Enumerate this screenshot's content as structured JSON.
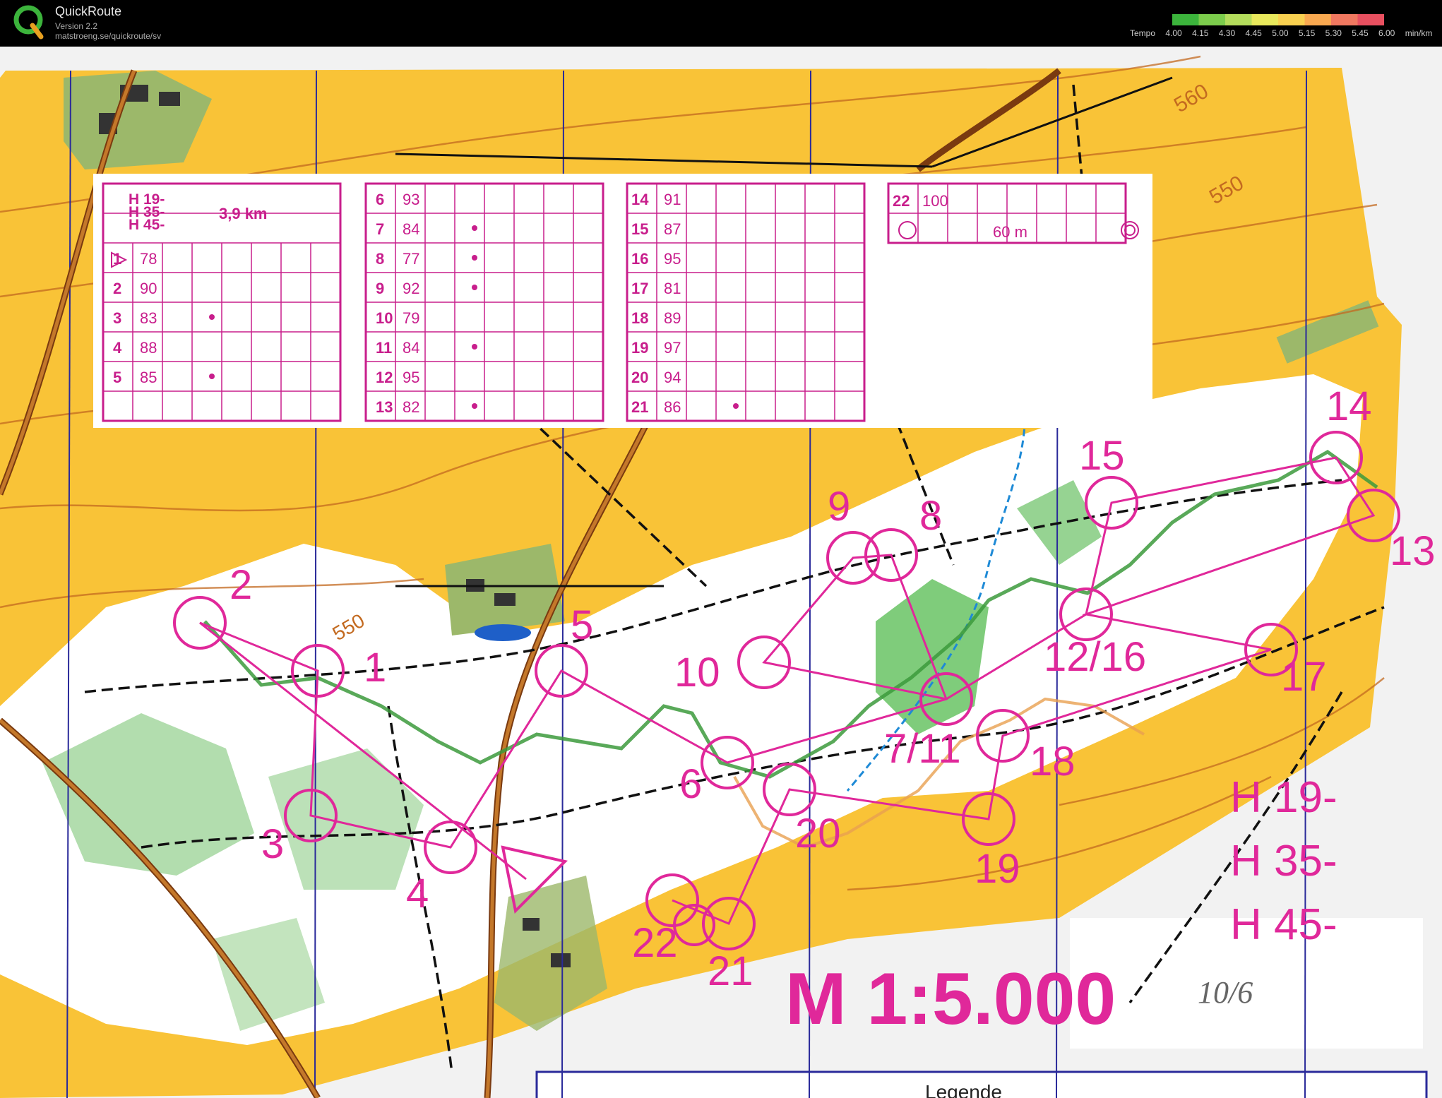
{
  "app": {
    "name": "QuickRoute",
    "version": "Version 2.2",
    "url": "matstroeng.se/quickroute/sv"
  },
  "tempo_legend": {
    "label": "Tempo",
    "ticks": [
      "4.00",
      "4.15",
      "4.30",
      "4.45",
      "5.00",
      "5.15",
      "5.30",
      "5.45",
      "6.00"
    ],
    "unit": "min/km",
    "colors": [
      "#3cb43c",
      "#7ccc4c",
      "#b4dc5c",
      "#e8e85c",
      "#f8d050",
      "#f8a850",
      "#f07860",
      "#e85060"
    ]
  },
  "map": {
    "paper_color": "#f2f2f2",
    "open_land_color": "#f9c337",
    "forest_color": "#ffffff",
    "green_color": "#9fd49a",
    "course_color": "#e0289a",
    "scale_text": "M 1:5.000",
    "class_labels": [
      "H 19-",
      "H 35-",
      "H 45-"
    ],
    "handwritten_note": "10/6",
    "legend_partial": "Legende",
    "contour_labels": [
      "560",
      "550",
      "550"
    ],
    "controls": [
      {
        "label": "1"
      },
      {
        "label": "2"
      },
      {
        "label": "3"
      },
      {
        "label": "4"
      },
      {
        "label": "5"
      },
      {
        "label": "6"
      },
      {
        "label": "7/11"
      },
      {
        "label": "8"
      },
      {
        "label": "9"
      },
      {
        "label": "10"
      },
      {
        "label": "12/16"
      },
      {
        "label": "13"
      },
      {
        "label": "14"
      },
      {
        "label": "15"
      },
      {
        "label": "17"
      },
      {
        "label": "18"
      },
      {
        "label": "19"
      },
      {
        "label": "20"
      },
      {
        "label": "21"
      },
      {
        "label": "22"
      }
    ]
  },
  "control_descriptions": {
    "header": {
      "classes": [
        "H 19-",
        "H 35-",
        "H 45-"
      ],
      "length": "3,9 km"
    },
    "rows_a": [
      {
        "num": "1",
        "code": "78"
      },
      {
        "num": "2",
        "code": "90"
      },
      {
        "num": "3",
        "code": "83"
      },
      {
        "num": "4",
        "code": "88"
      },
      {
        "num": "5",
        "code": "85"
      }
    ],
    "rows_b": [
      {
        "num": "6",
        "code": "93"
      },
      {
        "num": "7",
        "code": "84"
      },
      {
        "num": "8",
        "code": "77"
      },
      {
        "num": "9",
        "code": "92"
      },
      {
        "num": "10",
        "code": "79"
      },
      {
        "num": "11",
        "code": "84"
      },
      {
        "num": "12",
        "code": "95"
      },
      {
        "num": "13",
        "code": "82"
      }
    ],
    "rows_c": [
      {
        "num": "14",
        "code": "91"
      },
      {
        "num": "15",
        "code": "87"
      },
      {
        "num": "16",
        "code": "95"
      },
      {
        "num": "17",
        "code": "81"
      },
      {
        "num": "18",
        "code": "89"
      },
      {
        "num": "19",
        "code": "97"
      },
      {
        "num": "20",
        "code": "94"
      },
      {
        "num": "21",
        "code": "86"
      }
    ],
    "finish": {
      "num": "22",
      "code": "100",
      "distance": "60 m"
    }
  }
}
